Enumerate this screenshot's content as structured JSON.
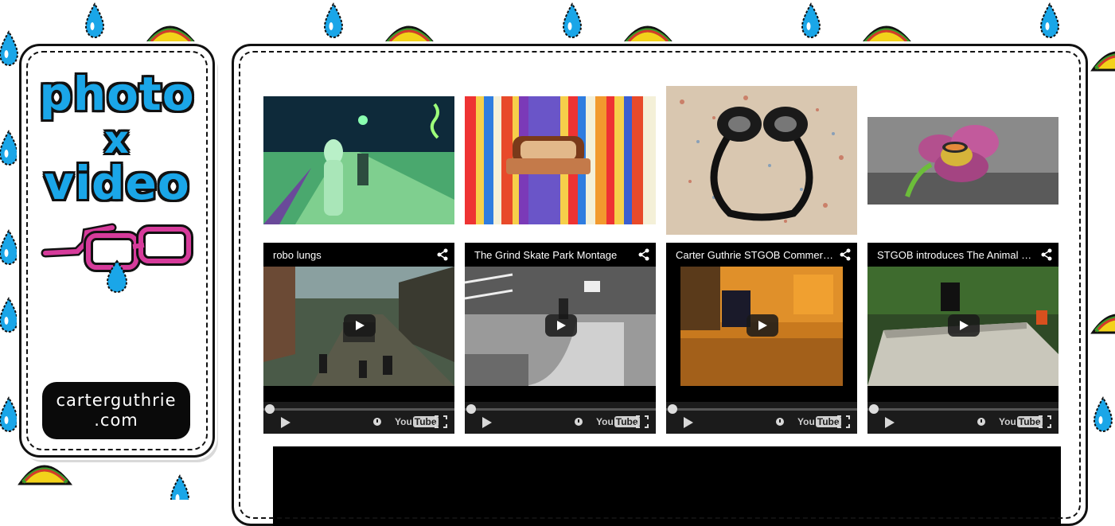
{
  "logo": {
    "line1": "photo",
    "line2": "x",
    "line3": "video",
    "site_line1": "carterguthrie",
    "site_line2": ".com"
  },
  "colors": {
    "brand_blue": "#1aa6e8",
    "glasses_pink": "#d63b9b",
    "video_bg": "#000000"
  },
  "photos": [
    {
      "name": "night-walk-photo"
    },
    {
      "name": "colorful-ring-photo"
    },
    {
      "name": "headphones-photo"
    },
    {
      "name": "flower-ring-photo"
    }
  ],
  "videos": [
    {
      "title": "robo lungs",
      "player": "YouTube"
    },
    {
      "title": "The Grind Skate Park Montage",
      "player": "YouTube"
    },
    {
      "title": "Carter Guthrie STGOB Commercial",
      "player": "YouTube"
    },
    {
      "title": "STGOB introduces The Animal C...",
      "player": "YouTube"
    }
  ]
}
